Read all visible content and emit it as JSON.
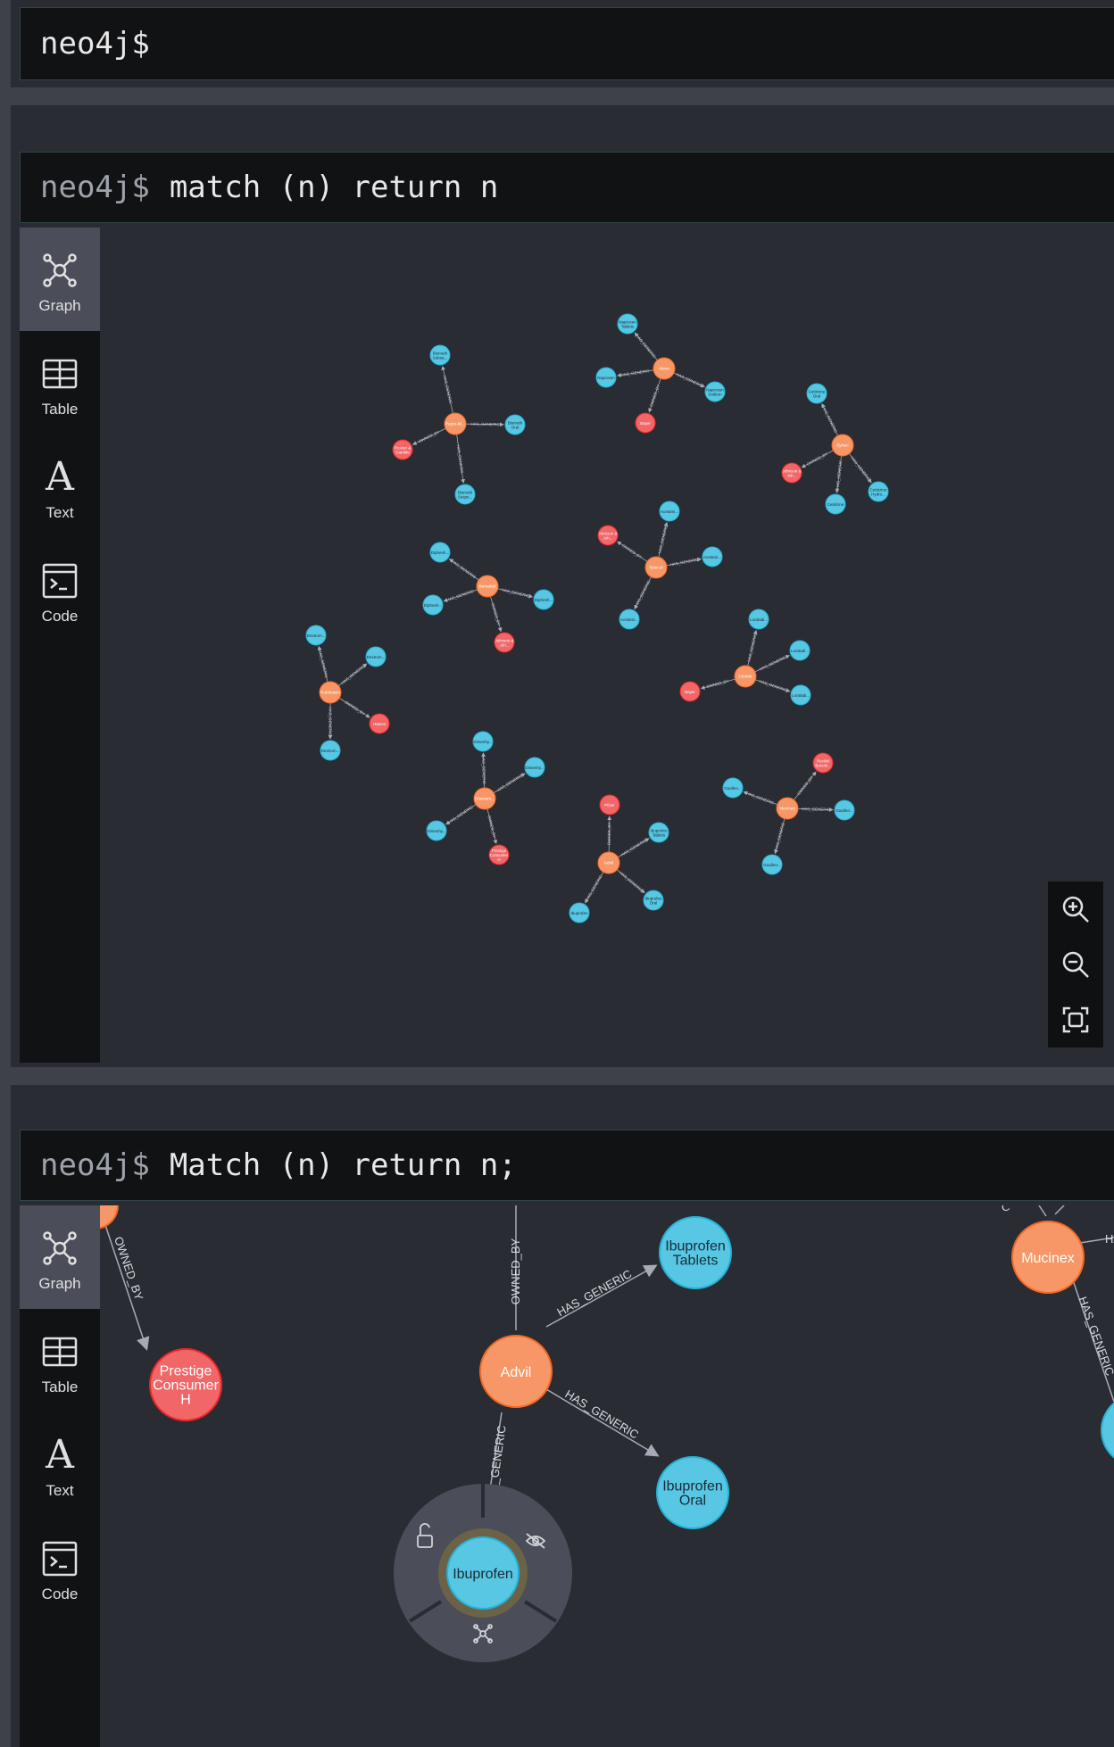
{
  "frames": [
    {
      "prompt": "neo4j$",
      "query": ""
    },
    {
      "prompt": "neo4j$",
      "query": "match (n) return n"
    },
    {
      "prompt": "neo4j$",
      "query": "Match (n) return n;"
    }
  ],
  "nav": {
    "graph": "Graph",
    "table": "Table",
    "text": "Text",
    "code": "Code"
  },
  "colors": {
    "drug_node": "#f79767",
    "generic_node": "#57c7e3",
    "owner_node": "#f16667",
    "background": "#2a2c33"
  },
  "icons": {
    "graph": "graph-icon",
    "table": "table-icon",
    "text": "text-icon",
    "code": "code-icon",
    "zoom_in": "zoom-in-icon",
    "zoom_out": "zoom-out-icon",
    "fit": "fit-icon",
    "unlock": "unlock-icon",
    "hide": "eye-off-icon",
    "expand": "expand-icon"
  },
  "overview_graph": {
    "clusters": [
      {
        "center": "Pepto-Bi...",
        "children": [
          {
            "label": "Bismuth Subsa...",
            "type": "generic"
          },
          {
            "label": "Bismuth Oral",
            "type": "generic"
          },
          {
            "label": "Bismuth Suspe...",
            "type": "generic"
          },
          {
            "label": "Procter & Gamble",
            "type": "owner"
          }
        ],
        "rels": [
          "HAS_GENERIC",
          "HAS_GENERIC",
          "HAS_GENERIC",
          "OWNED_BY"
        ]
      },
      {
        "center": "Aleve",
        "children": [
          {
            "label": "Naproxen Tablets",
            "type": "generic"
          },
          {
            "label": "Naproxen",
            "type": "generic"
          },
          {
            "label": "Naproxen Sodium",
            "type": "generic"
          },
          {
            "label": "Bayer",
            "type": "owner"
          }
        ],
        "rels": [
          "HAS_GENERIC",
          "HAS_GENERIC",
          "HAS_GENERIC",
          "OWNED_BY"
        ]
      },
      {
        "center": "Zyrtec",
        "children": [
          {
            "label": "Cetirizine Oral",
            "type": "generic"
          },
          {
            "label": "Johnson & Joh...",
            "type": "owner"
          },
          {
            "label": "Cetirizine",
            "type": "generic"
          },
          {
            "label": "Cetirizine Hydro...",
            "type": "generic"
          }
        ],
        "rels": [
          "HAS_GENERIC",
          "OWNED_BY",
          "HAS_GENERIC",
          "HAS_GENERIC"
        ]
      },
      {
        "center": "Benadryl",
        "children": [
          {
            "label": "Diphenh...",
            "type": "generic"
          },
          {
            "label": "Diphenh...",
            "type": "generic"
          },
          {
            "label": "Diphenh...",
            "type": "generic"
          },
          {
            "label": "Johnson & Joh...",
            "type": "owner"
          }
        ],
        "rels": [
          "HAS_GENERIC",
          "HAS_GENERIC",
          "HAS_GENERIC",
          "OWNED_BY"
        ]
      },
      {
        "center": "Tylenol",
        "children": [
          {
            "label": "Johnson & Joh...",
            "type": "owner"
          },
          {
            "label": "Acetami...",
            "type": "generic"
          },
          {
            "label": "Acetami...",
            "type": "generic"
          },
          {
            "label": "Acetami...",
            "type": "generic"
          }
        ],
        "rels": [
          "OWNED_BY",
          "HAS_GENERIC",
          "HAS_GENERIC",
          "HAS_GENERIC"
        ]
      },
      {
        "center": "Robitussin",
        "children": [
          {
            "label": "Dextrom...",
            "type": "generic"
          },
          {
            "label": "Dextrom...",
            "type": "generic"
          },
          {
            "label": "Haleon",
            "type": "owner"
          },
          {
            "label": "Dextrom...",
            "type": "generic"
          }
        ],
        "rels": [
          "HAS_GENERIC",
          "HAS_GENERIC",
          "OWNED_BY",
          "HAS_GENERIC"
        ]
      },
      {
        "center": "Claritin",
        "children": [
          {
            "label": "Loratadi...",
            "type": "generic"
          },
          {
            "label": "Loratadi...",
            "type": "generic"
          },
          {
            "label": "Loratadi...",
            "type": "generic"
          },
          {
            "label": "Bayer",
            "type": "owner"
          }
        ],
        "rels": [
          "HAS_GENERIC",
          "HAS_GENERIC",
          "HAS_GENERIC",
          "OWNED_BY"
        ]
      },
      {
        "center": "Dramam...",
        "children": [
          {
            "label": "Dimenhy...",
            "type": "generic"
          },
          {
            "label": "Dimenhy...",
            "type": "generic"
          },
          {
            "label": "Dimenhy...",
            "type": "generic"
          },
          {
            "label": "Prestige Consumer H",
            "type": "owner"
          }
        ],
        "rels": [
          "HAS_GENERIC",
          "HAS_GENERIC",
          "HAS_GENERIC",
          "OWNED_BY"
        ]
      },
      {
        "center": "Advil",
        "children": [
          {
            "label": "Pfizer",
            "type": "owner"
          },
          {
            "label": "Ibuprofen Tablets",
            "type": "generic"
          },
          {
            "label": "Ibuprofen Oral",
            "type": "generic"
          },
          {
            "label": "Ibuprofen",
            "type": "generic"
          }
        ],
        "rels": [
          "OWNED_BY",
          "HAS_GENERIC",
          "HAS_GENERIC",
          "HAS_GENERIC"
        ]
      },
      {
        "center": "Mucinex",
        "children": [
          {
            "label": "Reckitt Bencki...",
            "type": "owner"
          },
          {
            "label": "Guaifen...",
            "type": "generic"
          },
          {
            "label": "Guaifen...",
            "type": "generic"
          },
          {
            "label": "Guaifen...",
            "type": "generic"
          }
        ],
        "rels": [
          "OWNED_BY",
          "HAS_GENERIC",
          "HAS_GENERIC",
          "HAS_GENERIC"
        ]
      }
    ]
  },
  "detail_graph": {
    "nodes": {
      "top_left_owner": "Prestige Consumer H",
      "advil": "Advil",
      "ibuprofen_tablets": "Ibuprofen Tablets",
      "ibuprofen_oral": "Ibuprofen Oral",
      "ibuprofen": "Ibuprofen",
      "mucinex": "Mucinex"
    },
    "rels": {
      "owned_by_left": "OWNED_BY",
      "owned_by_top": "OWNED_BY",
      "advil_tablets": "HAS_GENERIC",
      "advil_oral": "HAS_GENERIC",
      "advil_ibuprofen": "_GENERIC",
      "mucinex_right": "HAS_GENERIC",
      "mucinex_top": "HAS",
      "mucinex_cut": "C"
    }
  }
}
